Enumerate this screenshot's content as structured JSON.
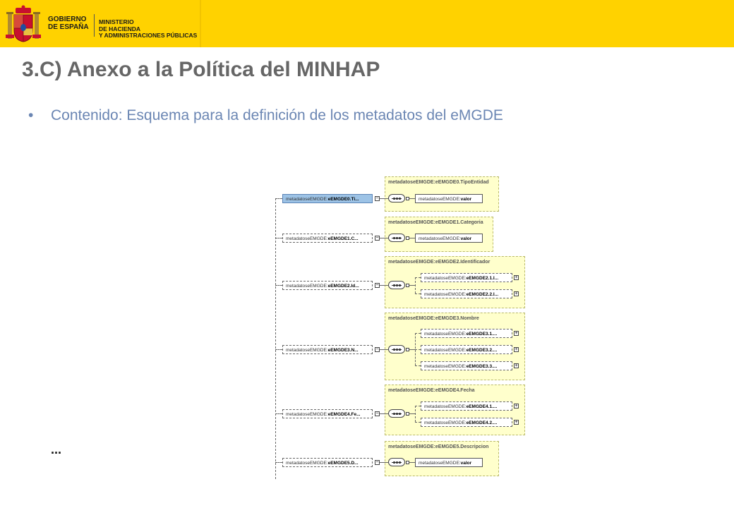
{
  "header": {
    "gov_line1": "GOBIERNO",
    "gov_line2": "DE ESPAÑA",
    "min_line1": "MINISTERIO",
    "min_line2": "DE HACIENDA",
    "min_line3": "Y ADMINISTRACIONES PÚBLICAS"
  },
  "slide": {
    "title": "3.C) Anexo a la Política del MINHAP",
    "bullet": "Contenido: Esquema para la definición de los metadatos del eMGDE",
    "ellipsis": "..."
  },
  "diagram": {
    "prefix": "metadatoseEMGDE:",
    "elements": [
      {
        "name": "eEMGDE0.Ti...",
        "group": "metadatoseEMGDE:eEMGDE0.TipoEntidad",
        "children": [
          "valor"
        ]
      },
      {
        "name": "eEMGDE1.C...",
        "group": "metadatoseEMGDE:eEMGDE1.Categoria",
        "children": [
          "valor"
        ]
      },
      {
        "name": "eEMGDE2.Id...",
        "group": "metadatoseEMGDE:eEMGDE2.Identificador",
        "children": [
          "eEMGDE2.1.I...",
          "eEMGDE2.2.I..."
        ]
      },
      {
        "name": "eEMGDE3.N...",
        "group": "metadatoseEMGDE:eEMGDE3.Nombre",
        "children": [
          "eEMGDE3.1....",
          "eEMGDE3.2....",
          "eEMGDE3.3...."
        ]
      },
      {
        "name": "eEMGDE4.Fe...",
        "group": "metadatoseEMGDE:eEMGDE4.Fecha",
        "children": [
          "eEMGDE4.1....",
          "eEMGDE4.2...."
        ]
      },
      {
        "name": "eEMGDE5.D...",
        "group": "metadatoseEMGDE:eEMGDE5.Descripcion",
        "children": [
          "valor"
        ]
      }
    ]
  },
  "colors": {
    "banner": "#ffd200",
    "title": "#666666",
    "bullet": "#6b86b3",
    "group_fill": "#ffffcc",
    "selected_node": "#9dc3e6"
  }
}
